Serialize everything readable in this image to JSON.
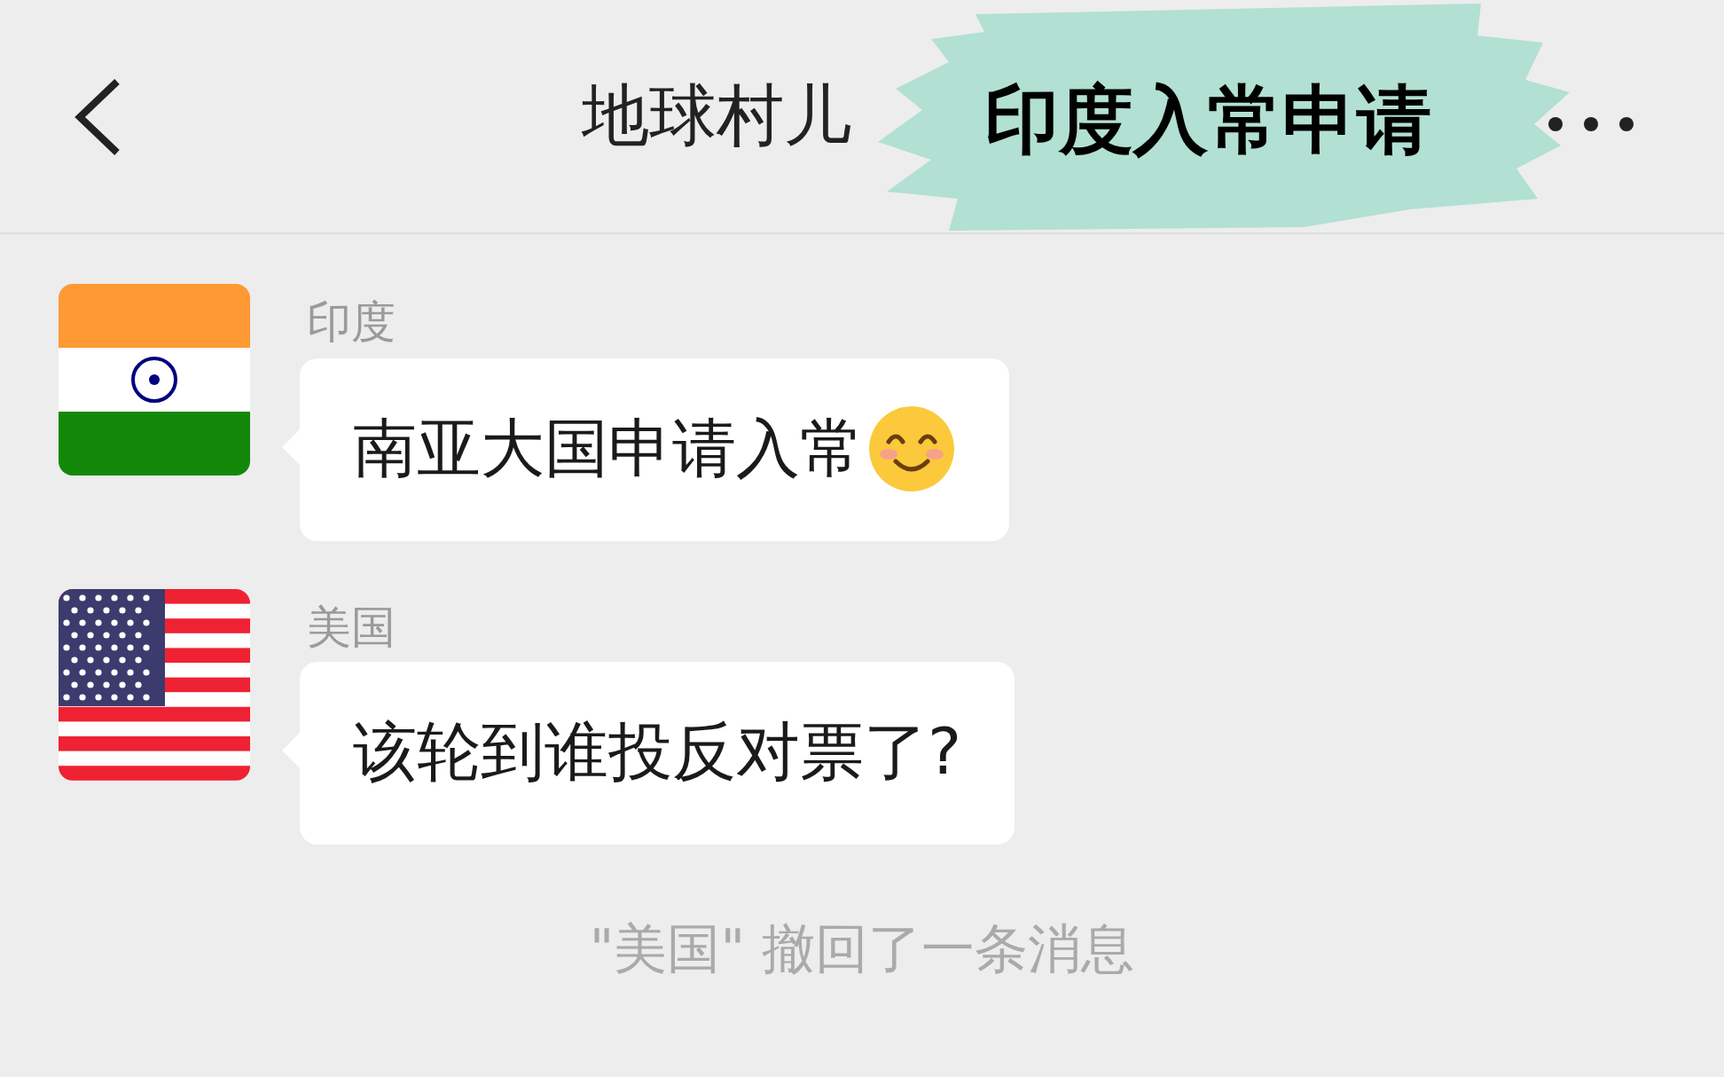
{
  "header": {
    "title": "地球村儿"
  },
  "caption": {
    "text": "印度入常申请"
  },
  "messages": [
    {
      "sender": "印度",
      "avatar": {
        "kind": "india"
      },
      "trailing_emoji": true,
      "text": "南亚大国申请入常"
    },
    {
      "sender": "美国",
      "avatar": {
        "kind": "usa"
      },
      "trailing_emoji": false,
      "text": "该轮到谁投反对票了?"
    }
  ],
  "notice": "\"美国\" 撤回了一条消息"
}
